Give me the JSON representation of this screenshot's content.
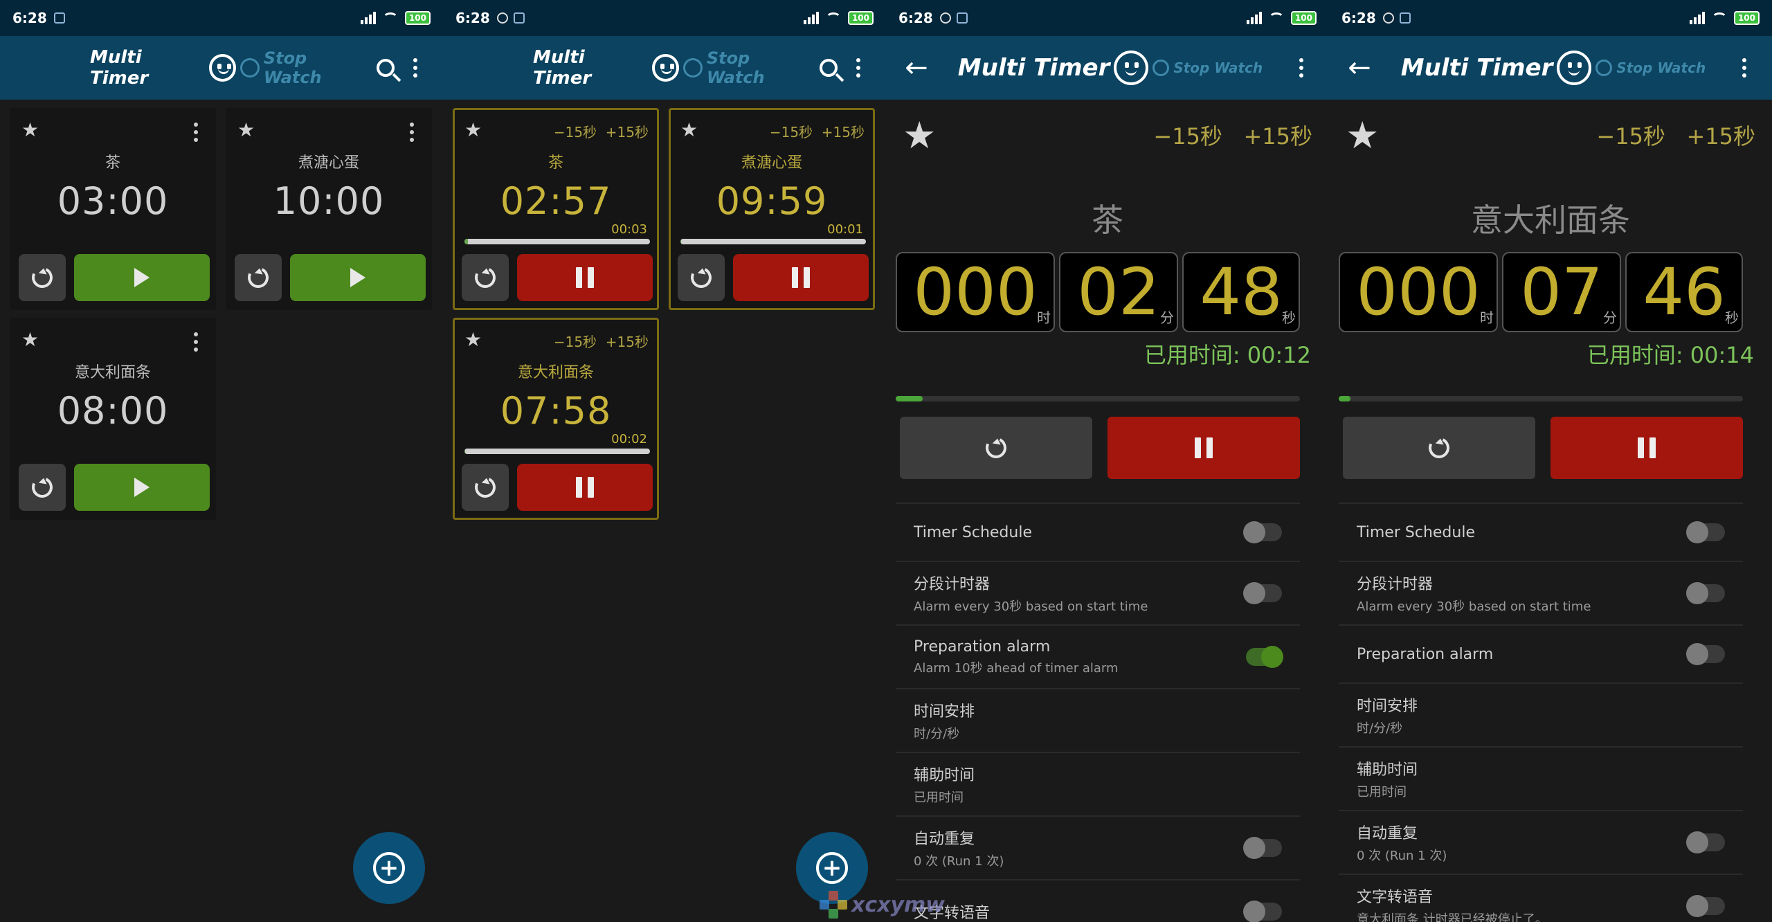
{
  "colors": {
    "statusbar": "#03263a",
    "appbar": "#0b4360",
    "play": "#4c8a1d",
    "pause": "#a3160d",
    "accent_gold": "#c8b43b",
    "elapsed_green": "#7cc35a"
  },
  "status": {
    "time": "6:28",
    "battery": "100"
  },
  "appbar": {
    "brand": "Multi Timer",
    "stopwatch": "Stop Watch"
  },
  "panel1": {
    "cards": [
      {
        "name": "茶",
        "time": "03:00"
      },
      {
        "name": "煮溏心蛋",
        "time": "10:00"
      },
      {
        "name": "意大利面条",
        "time": "08:00"
      }
    ]
  },
  "panel2": {
    "minus": "−15秒",
    "plus": "+15秒",
    "cards": [
      {
        "name": "茶",
        "time": "02:57",
        "elapsed": "00:03",
        "progress": 0.017
      },
      {
        "name": "煮溏心蛋",
        "time": "09:59",
        "elapsed": "00:01",
        "progress": 0.002
      },
      {
        "name": "意大利面条",
        "time": "07:58",
        "elapsed": "00:02",
        "progress": 0.004
      }
    ]
  },
  "panel3": {
    "minus": "−15秒",
    "plus": "+15秒",
    "name": "茶",
    "hours": "000",
    "minutes": "02",
    "seconds": "48",
    "unit_h": "时",
    "unit_m": "分",
    "unit_s": "秒",
    "elapsed": "已用时间: 00:12",
    "progress": 0.067,
    "settings": [
      {
        "title": "Timer Schedule",
        "sub": "",
        "toggle": "off"
      },
      {
        "title": "分段计时器",
        "sub": "Alarm every 30秒 based on start time",
        "toggle": "off"
      },
      {
        "title": "Preparation alarm",
        "sub": "Alarm 10秒 ahead of timer alarm",
        "toggle": "on"
      },
      {
        "title": "时间安排",
        "sub": "时/分/秒",
        "toggle": "none"
      },
      {
        "title": "辅助时间",
        "sub": "已用时间",
        "toggle": "none"
      },
      {
        "title": "自动重复",
        "sub": "0 次 (Run 1 次)",
        "toggle": "off"
      },
      {
        "title": "文字转语音",
        "sub": "",
        "toggle": "off"
      }
    ]
  },
  "panel4": {
    "minus": "−15秒",
    "plus": "+15秒",
    "name": "意大利面条",
    "hours": "000",
    "minutes": "07",
    "seconds": "46",
    "unit_h": "时",
    "unit_m": "分",
    "unit_s": "秒",
    "elapsed": "已用时间: 00:14",
    "progress": 0.029,
    "settings": [
      {
        "title": "Timer Schedule",
        "sub": "",
        "toggle": "off"
      },
      {
        "title": "分段计时器",
        "sub": "Alarm every 30秒 based on start time",
        "toggle": "off"
      },
      {
        "title": "Preparation alarm",
        "sub": "",
        "toggle": "off"
      },
      {
        "title": "时间安排",
        "sub": "时/分/秒",
        "toggle": "none"
      },
      {
        "title": "辅助时间",
        "sub": "已用时间",
        "toggle": "none"
      },
      {
        "title": "自动重复",
        "sub": "0 次 (Run 1 次)",
        "toggle": "off"
      },
      {
        "title": "文字转语音",
        "sub": "意大利面条 计时器已经被停止了。",
        "toggle": "off"
      }
    ]
  },
  "watermark": "xcxymw"
}
